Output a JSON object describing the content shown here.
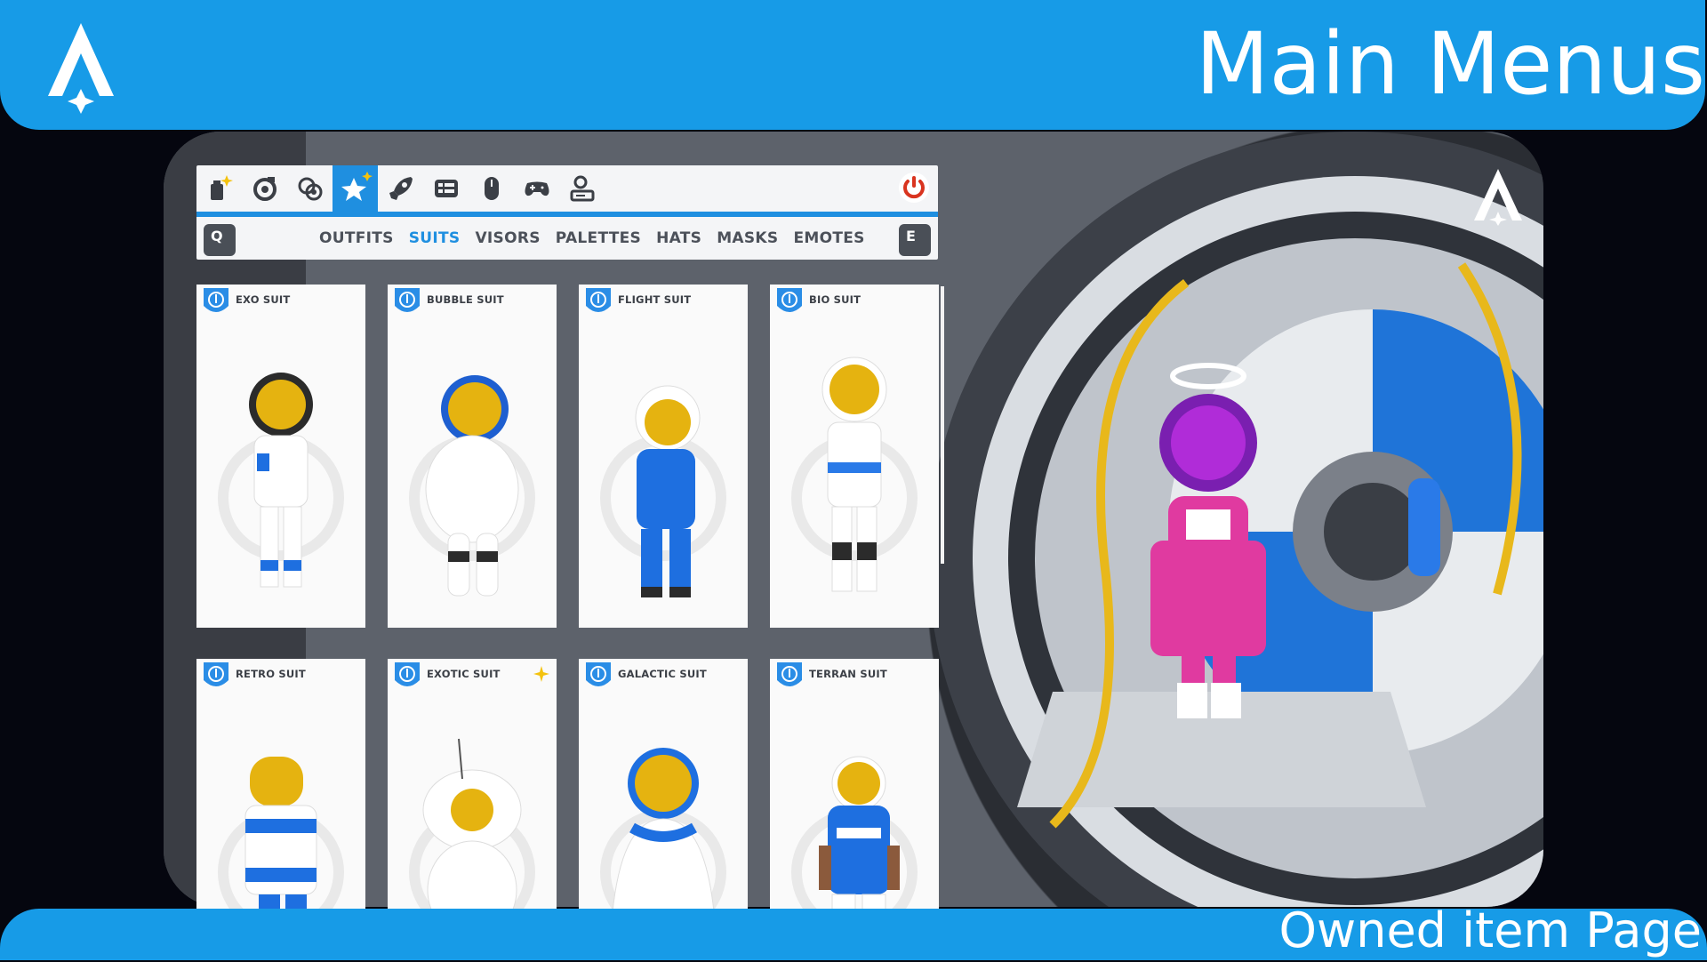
{
  "header": {
    "title": "Main Menus",
    "logo_icon": "astroneer-a-logo-icon"
  },
  "footer": {
    "title": "Owned item Page"
  },
  "menu": {
    "tab_icons": [
      "new-items-icon",
      "backpack-icon",
      "research-icon",
      "customize-star-icon",
      "rocket-icon",
      "settings-list-icon",
      "mouse-icon",
      "gamepad-icon",
      "player-status-icon"
    ],
    "active_tab": "customize-star-icon",
    "power_icon": "power-icon",
    "prev_key": "Q",
    "next_key": "E",
    "categories": [
      "OUTFITS",
      "SUITS",
      "VISORS",
      "PALETTES",
      "HATS",
      "MASKS",
      "EMOTES"
    ],
    "active_category": "SUITS"
  },
  "suits": [
    {
      "name": "EXO SUIT",
      "body": "#ffffff",
      "accent": "#1e6fe0"
    },
    {
      "name": "BUBBLE SUIT",
      "body": "#ffffff",
      "accent": "#1e5fd0"
    },
    {
      "name": "FLIGHT SUIT",
      "body": "#1e6fe0",
      "accent": "#ffffff"
    },
    {
      "name": "BIO SUIT",
      "body": "#ffffff",
      "accent": "#2a7ae8"
    },
    {
      "name": "RETRO SUIT",
      "body": "#1e6fe0",
      "accent": "#ffffff"
    },
    {
      "name": "EXOTIC SUIT",
      "body": "#ffffff",
      "accent": "#2a7ae8",
      "new": true
    },
    {
      "name": "GALACTIC SUIT",
      "body": "#ffffff",
      "accent": "#1e6fe0"
    },
    {
      "name": "TERRAN SUIT",
      "body": "#1e6fe0",
      "accent": "#8b5a3c"
    }
  ],
  "colors": {
    "accent": "#179be7",
    "active_tab": "#1f8fe0",
    "player_suit": "#e03aa0",
    "visor": "#d4a10a"
  }
}
